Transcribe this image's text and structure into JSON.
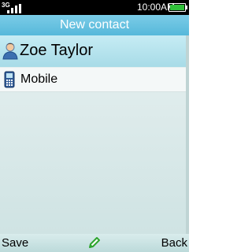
{
  "status_bar": {
    "network_label": "3G",
    "time": "10:00AM",
    "battery_color": "#31c13a"
  },
  "header": {
    "title": "New contact"
  },
  "contact": {
    "name": "Zoe Taylor",
    "name_icon": "contact-person-icon",
    "phone_type_label": "Mobile",
    "phone_icon": "mobile-phone-icon"
  },
  "softkeys": {
    "left_label": "Save",
    "center_icon": "pencil-edit-icon",
    "right_label": "Back"
  },
  "colors": {
    "title_bar": "#5cbcdc",
    "selected_row": "#b4e2ec",
    "softkey_bar": "#c8e2e2"
  }
}
